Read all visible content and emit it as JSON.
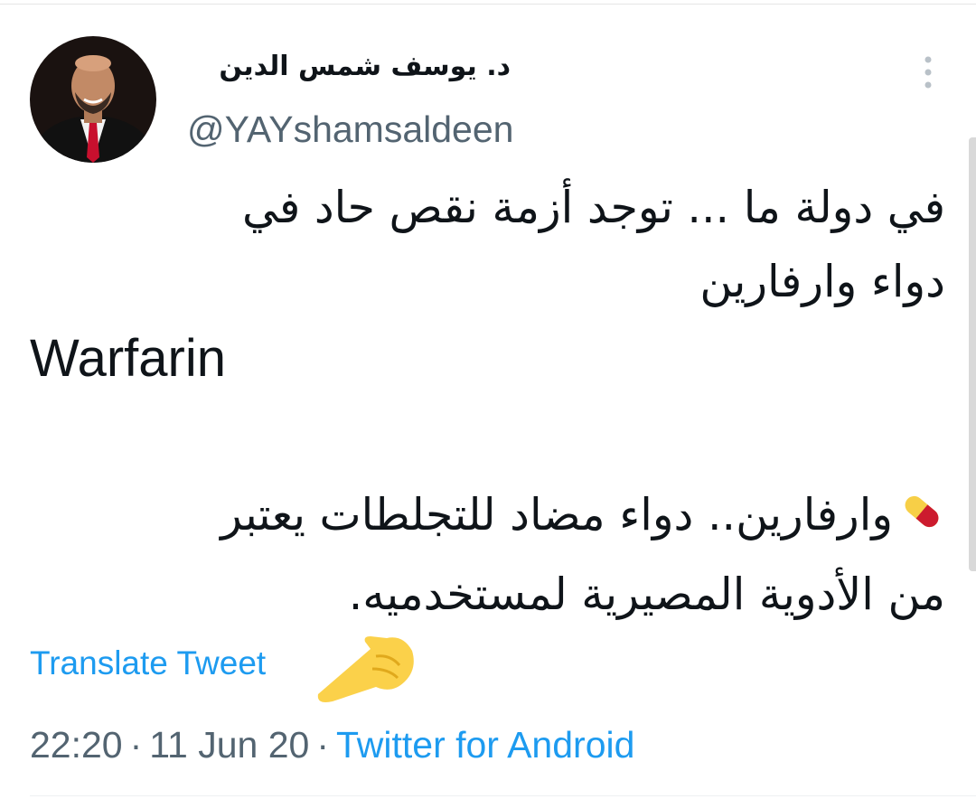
{
  "author": {
    "display_name": "د. يوسف شمس الدين",
    "handle": "@YAYshamsaldeen"
  },
  "tweet": {
    "line_1": "في دولة ما ... توجد أزمة نقص حاد في",
    "line_2": "دواء وارفارين",
    "line_3": "Warfarin",
    "line_4": "وارفارين.. دواء مضاد للتجلطات يعتبر",
    "line_5": "من الأدوية المصيرية لمستخدميه."
  },
  "actions": {
    "translate_label": "Translate Tweet"
  },
  "meta": {
    "time": "22:20",
    "separator": "·",
    "date": "11 Jun 20",
    "source": "Twitter for Android"
  },
  "icons": {
    "more": "more-vertical-icon",
    "pill": "pill-emoji-icon",
    "pointer": "pointing-hand-emoji-icon"
  },
  "colors": {
    "link": "#1d9bf0",
    "secondary_text": "#536471",
    "primary_text": "#0f1419"
  }
}
